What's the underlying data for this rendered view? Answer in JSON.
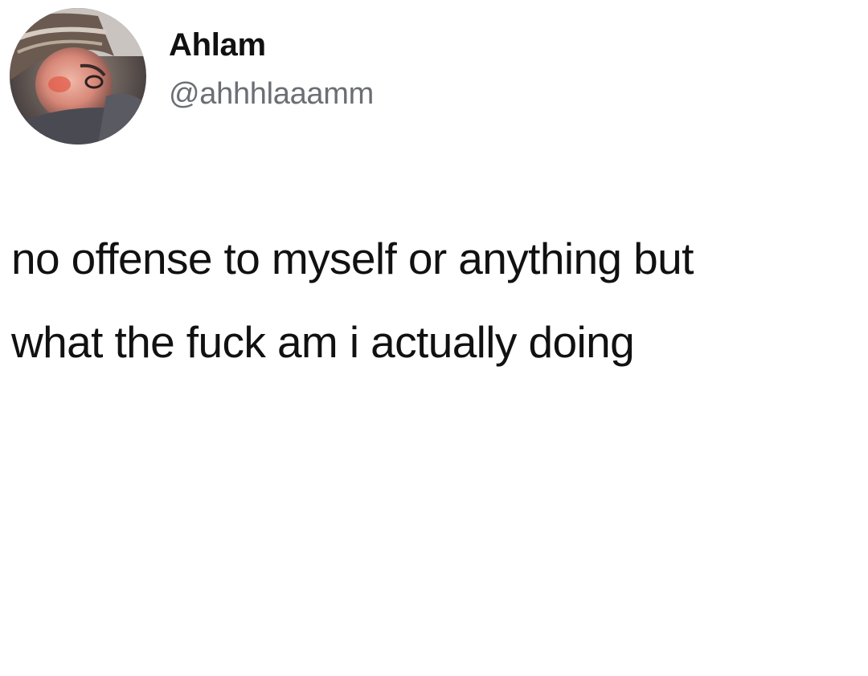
{
  "tweet": {
    "author": {
      "display_name": "Ahlam",
      "handle": "@ahhhlaaamm",
      "avatar_icon": "profile-photo"
    },
    "text_lines": [
      "no offense to myself or anything but",
      "what the fuck am i actually doing"
    ]
  },
  "colors": {
    "background": "#ffffff",
    "text": "#111111",
    "handle": "#6b6f74"
  }
}
